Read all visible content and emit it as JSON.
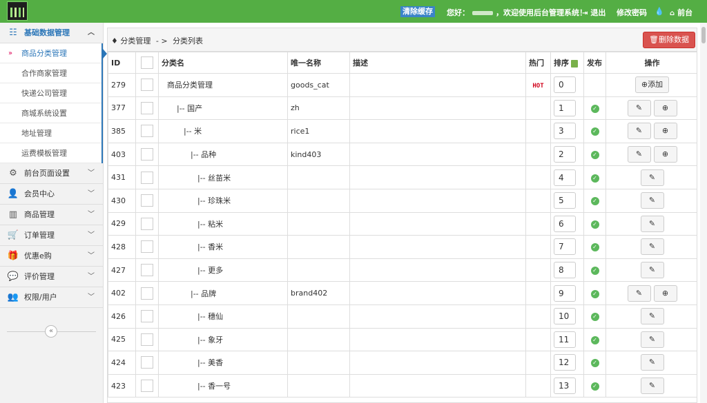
{
  "topbar": {
    "clear_cache": "清除缓存",
    "greeting_prefix": "您好：",
    "greeting_suffix": "，欢迎使用后台管理系统！",
    "logout": "退出",
    "change_password": "修改密码",
    "front": "前台"
  },
  "sidebar": {
    "sections": [
      {
        "label": "基础数据管理",
        "icon": "sitemap-icon",
        "active": true
      },
      {
        "label": "前台页面设置",
        "icon": "gears-icon"
      },
      {
        "label": "会员中心",
        "icon": "user-icon"
      },
      {
        "label": "商品管理",
        "icon": "barcode-icon"
      },
      {
        "label": "订单管理",
        "icon": "cart-icon"
      },
      {
        "label": "优惠e购",
        "icon": "gift-icon"
      },
      {
        "label": "评价管理",
        "icon": "comments-icon"
      },
      {
        "label": "权限/用户",
        "icon": "users-icon"
      }
    ],
    "subitems": [
      {
        "label": "商品分类管理",
        "active": true
      },
      {
        "label": "合作商家管理"
      },
      {
        "label": "快递公司管理"
      },
      {
        "label": "商城系统设置"
      },
      {
        "label": "地址管理"
      },
      {
        "label": "运费模板管理"
      }
    ]
  },
  "breadcrumb": {
    "root": "分类管理",
    "sep": "- >",
    "current": "分类列表"
  },
  "delete_button": "删除数据",
  "table": {
    "headers": {
      "id": "ID",
      "name": "分类名",
      "unique": "唯一名称",
      "desc": "描述",
      "hot": "热门",
      "sort": "排序",
      "publish": "发布",
      "ops": "操作"
    },
    "hot_badge": "HOT",
    "add_label": "添加",
    "rows": [
      {
        "id": "279",
        "name": "商品分类管理",
        "unique": "goods_cat",
        "hot": true,
        "sort": "0",
        "publish": false,
        "ops": "add"
      },
      {
        "id": "377",
        "name": "|-- 国产",
        "unique": "zh",
        "sort": "1",
        "publish": true,
        "ops": "edit_plus"
      },
      {
        "id": "385",
        "name": "|-- 米",
        "unique": "rice1",
        "sort": "3",
        "publish": true,
        "ops": "edit_plus"
      },
      {
        "id": "403",
        "name": "|-- 品种",
        "unique": "kind403",
        "sort": "2",
        "publish": true,
        "ops": "edit_plus"
      },
      {
        "id": "431",
        "name": "|-- 丝苗米",
        "unique": "",
        "sort": "4",
        "publish": true,
        "ops": "edit"
      },
      {
        "id": "430",
        "name": "|-- 珍珠米",
        "unique": "",
        "sort": "5",
        "publish": true,
        "ops": "edit"
      },
      {
        "id": "429",
        "name": "|-- 粘米",
        "unique": "",
        "sort": "6",
        "publish": true,
        "ops": "edit"
      },
      {
        "id": "428",
        "name": "|-- 香米",
        "unique": "",
        "sort": "7",
        "publish": true,
        "ops": "edit"
      },
      {
        "id": "427",
        "name": "|-- 更多",
        "unique": "",
        "sort": "8",
        "publish": true,
        "ops": "edit"
      },
      {
        "id": "402",
        "name": "|-- 品牌",
        "unique": "brand402",
        "sort": "9",
        "publish": true,
        "ops": "edit_plus"
      },
      {
        "id": "426",
        "name": "|-- 穗仙",
        "unique": "",
        "sort": "10",
        "publish": true,
        "ops": "edit"
      },
      {
        "id": "425",
        "name": "|-- 象牙",
        "unique": "",
        "sort": "11",
        "publish": true,
        "ops": "edit"
      },
      {
        "id": "424",
        "name": "|-- 美香",
        "unique": "",
        "sort": "12",
        "publish": true,
        "ops": "edit"
      },
      {
        "id": "423",
        "name": "|-- 香一号",
        "unique": "",
        "sort": "13",
        "publish": true,
        "ops": "edit"
      }
    ]
  }
}
